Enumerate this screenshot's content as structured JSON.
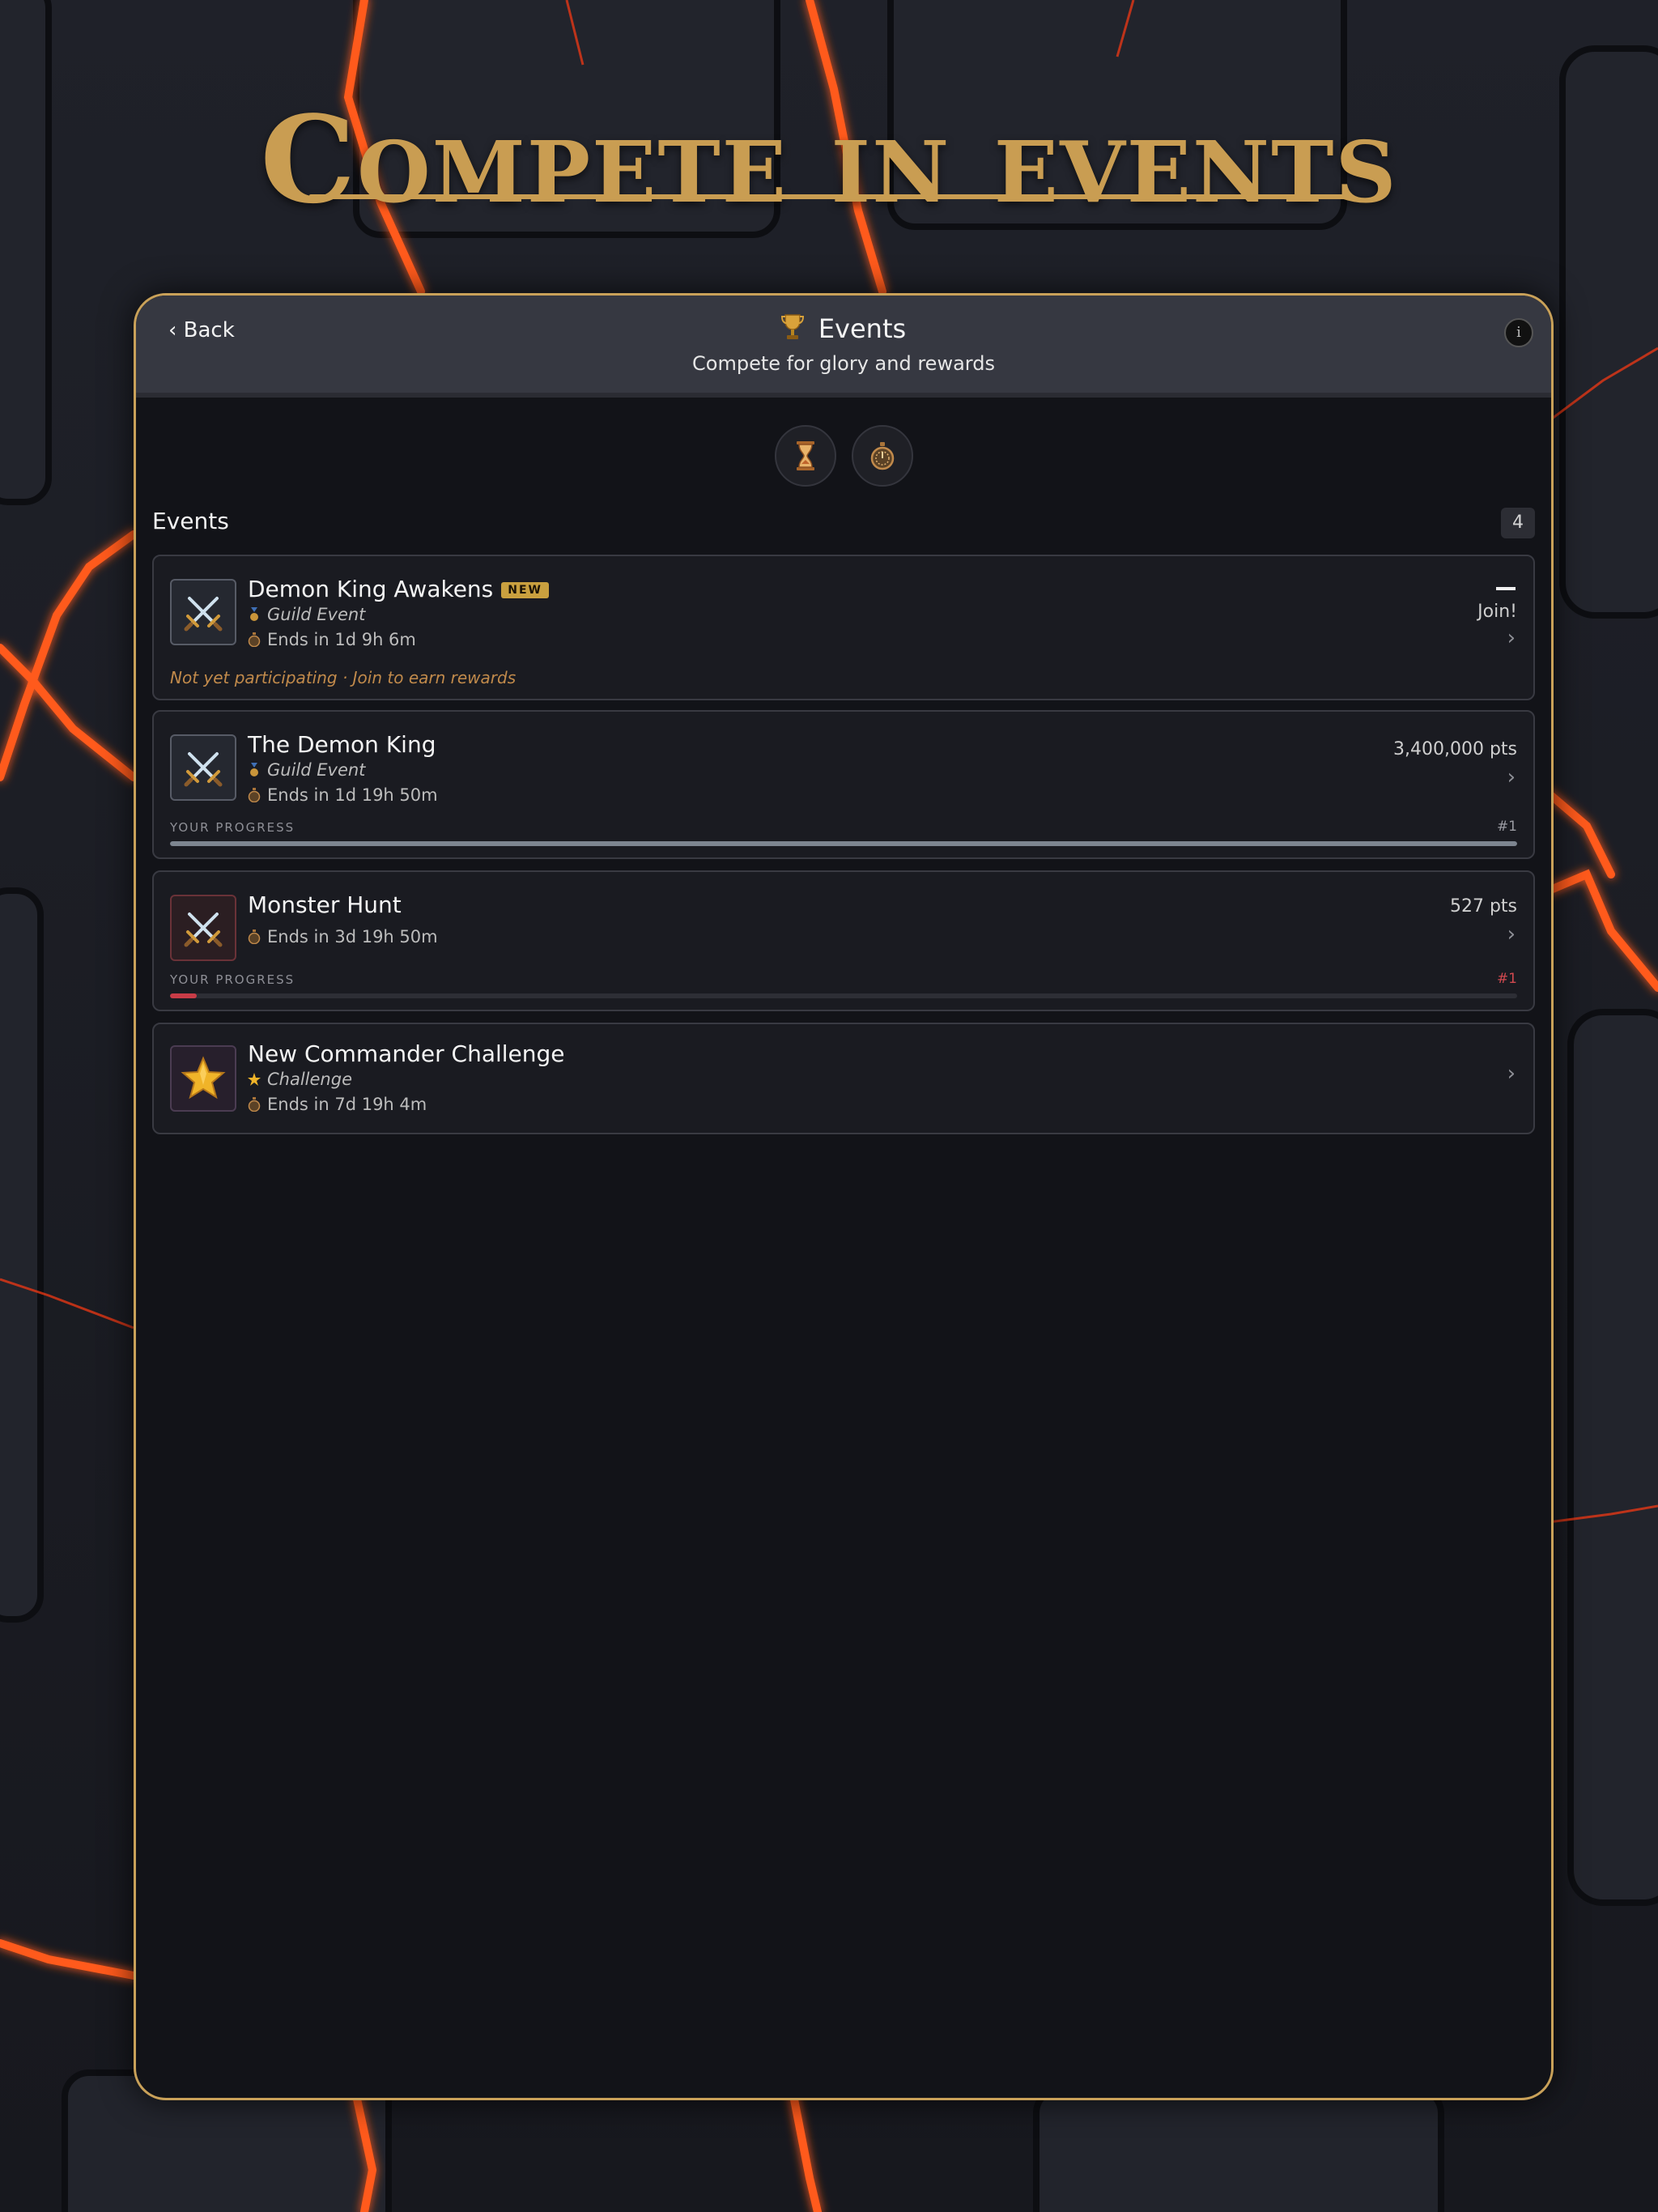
{
  "headline": "Compete in events",
  "topbar": {
    "back_label": "‹ Back",
    "title": "Events",
    "subtitle": "Compete for glory and rewards",
    "info_label": "i"
  },
  "filters": [
    {
      "icon": "hourglass-icon"
    },
    {
      "icon": "stopwatch-icon"
    }
  ],
  "section": {
    "title": "Events",
    "count": "4"
  },
  "events": [
    {
      "title": "Demon King Awakens",
      "badge": "NEW",
      "type": "Guild Event",
      "ends": "Ends in 1d 9h 6m",
      "right_label": "Join!",
      "notice": "Not yet participating · Join to earn rewards",
      "icon": "crossed-swords-icon"
    },
    {
      "title": "The Demon King",
      "type": "Guild Event",
      "ends": "Ends in 1d 19h 50m",
      "points": "3,400,000 pts",
      "progress_label": "YOUR PROGRESS",
      "rank": "#1",
      "progress": 1.0,
      "icon": "crossed-swords-icon"
    },
    {
      "title": "Monster Hunt",
      "ends": "Ends in 3d 19h 50m",
      "points": "527 pts",
      "progress_label": "YOUR PROGRESS",
      "rank": "#1",
      "progress": 0.02,
      "icon": "crossed-swords-icon"
    },
    {
      "title": "New Commander Challenge",
      "type": "Challenge",
      "ends": "Ends in 7d 19h 4m",
      "icon": "star-icon"
    }
  ],
  "colors": {
    "accent_gold": "#c99d52",
    "lava": "#ff5a1f",
    "progress_gray": "#7d8590",
    "progress_red": "#c83c47"
  }
}
